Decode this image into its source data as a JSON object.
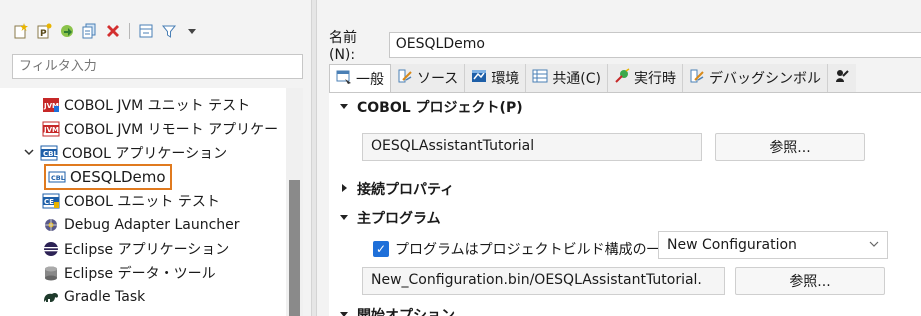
{
  "toolbar": {
    "icons": [
      "new-config-icon",
      "new-prototype-icon",
      "export-icon",
      "duplicate-icon",
      "delete-icon",
      "collapse-all-icon",
      "filter-icon",
      "view-menu-icon"
    ]
  },
  "filter": {
    "placeholder": "フィルタ入力"
  },
  "tree": {
    "items": [
      {
        "label": "COBOL JVM ユニット テスト",
        "icon": "cobol-jvm-unit-icon"
      },
      {
        "label": "COBOL JVM リモート アプリケー",
        "icon": "cobol-jvm-remote-icon"
      },
      {
        "label": "COBOL アプリケーション",
        "icon": "cobol-app-icon",
        "expanded": true
      },
      {
        "label": "OESQLDemo",
        "icon": "cbl-config-icon",
        "selected": true
      },
      {
        "label": "COBOL ユニット テスト",
        "icon": "cobol-unit-icon"
      },
      {
        "label": "Debug Adapter Launcher",
        "icon": "debug-adapter-icon"
      },
      {
        "label": "Eclipse アプリケーション",
        "icon": "eclipse-icon"
      },
      {
        "label": "Eclipse データ・ツール",
        "icon": "data-tools-icon"
      },
      {
        "label": "Gradle Task",
        "icon": "gradle-icon"
      }
    ]
  },
  "config": {
    "name_label": "名前(N):",
    "name_value": "OESQLDemo"
  },
  "tabs": [
    {
      "label": "一般",
      "icon": "general-tab-icon",
      "active": true
    },
    {
      "label": "ソース",
      "icon": "source-tab-icon"
    },
    {
      "label": "環境",
      "icon": "environment-tab-icon"
    },
    {
      "label": "共通(C)",
      "icon": "common-tab-icon"
    },
    {
      "label": "実行時",
      "icon": "runtime-tab-icon"
    },
    {
      "label": "デバッグシンボル",
      "icon": "debug-symbols-tab-icon"
    }
  ],
  "general": {
    "project_section": "COBOL プロジェクト(P)",
    "project_value": "OESQLAssistantTutorial",
    "browse_label": "参照...",
    "connection_section": "接続プロパティ",
    "main_program_section": "主プログラム",
    "checkbox_label": "プログラムはプロジェクトビルド構成の一部:",
    "build_config": "New Configuration",
    "program_path": "New_Configuration.bin/OESQLAssistantTutorial.",
    "browse_label_2": "参照...",
    "startup_section": "開始オプション"
  },
  "colors": {
    "selection_border": "#e07a1f",
    "checkbox": "#1e6fd9"
  }
}
